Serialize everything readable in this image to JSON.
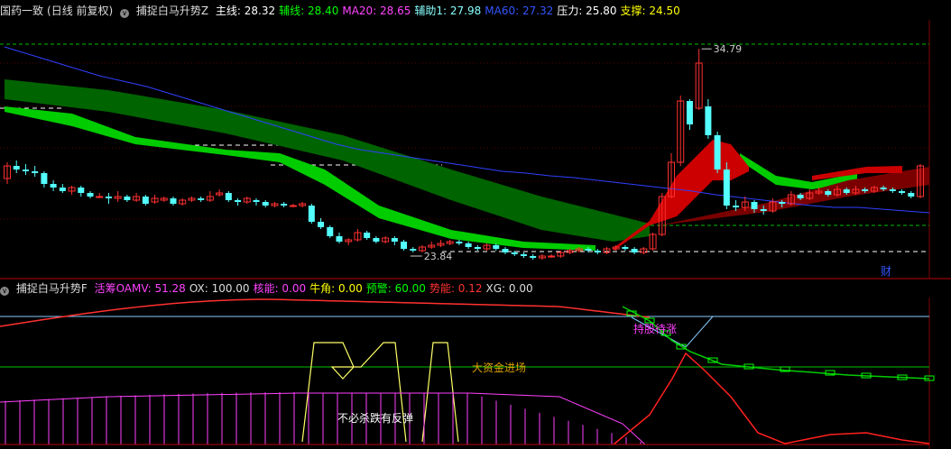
{
  "top_header": {
    "stock": "国药一致",
    "mode": "(日线 前复权)",
    "indicator": "捕捉白马升势Z",
    "items": [
      {
        "label": "主线:",
        "value": "28.32",
        "color": "#ffffff"
      },
      {
        "label": "辅线:",
        "value": "28.40",
        "color": "#00ff00"
      },
      {
        "label": "MA20:",
        "value": "28.65",
        "color": "#ff44ff"
      },
      {
        "label": "辅助1:",
        "value": "27.98",
        "color": "#88ffff"
      },
      {
        "label": "MA60:",
        "value": "27.32",
        "color": "#3355ff"
      },
      {
        "label": "压力:",
        "value": "25.80",
        "color": "#ffffff"
      },
      {
        "label": "支撑:",
        "value": "24.50",
        "color": "#ffff00"
      }
    ]
  },
  "bottom_header": {
    "indicator": "捕捉白马升势F",
    "items": [
      {
        "label": "活筹OAMV:",
        "value": "51.28",
        "color": "#ff44ff"
      },
      {
        "label": "OX:",
        "value": "100.00",
        "color": "#dddddd"
      },
      {
        "label": "核能:",
        "value": "0.00",
        "color": "#ff44ff"
      },
      {
        "label": "牛角:",
        "value": "0.00",
        "color": "#ffff00"
      },
      {
        "label": "预警:",
        "value": "60.00",
        "color": "#00ff00"
      },
      {
        "label": "势能:",
        "value": "0.12",
        "color": "#ff3333"
      },
      {
        "label": "XG:",
        "value": "0.00",
        "color": "#dddddd"
      }
    ]
  },
  "chart_data": {
    "type": "candlestick",
    "high_label": "34.79",
    "low_label": "23.84",
    "caiwu_marker": "财",
    "candles": [
      [
        27.6,
        28.3,
        28.5,
        27.3
      ],
      [
        28.3,
        28.1,
        28.6,
        27.9
      ],
      [
        28.1,
        28.0,
        28.4,
        27.8
      ],
      [
        28.0,
        27.9,
        28.3,
        27.7
      ],
      [
        27.9,
        27.3,
        28.0,
        27.1
      ],
      [
        27.3,
        27.1,
        27.5,
        26.9
      ],
      [
        27.1,
        26.9,
        27.3,
        26.8
      ],
      [
        26.9,
        27.1,
        27.2,
        26.7
      ],
      [
        27.1,
        26.8,
        27.2,
        26.6
      ],
      [
        26.8,
        26.6,
        26.9,
        26.5
      ],
      [
        26.6,
        26.6,
        26.8,
        26.5
      ],
      [
        26.6,
        26.5,
        26.8,
        26.2
      ],
      [
        26.5,
        26.6,
        26.9,
        26.3
      ],
      [
        26.6,
        26.4,
        26.7,
        26.3
      ],
      [
        26.4,
        26.6,
        26.8,
        26.3
      ],
      [
        26.6,
        26.2,
        26.7,
        26.1
      ],
      [
        26.3,
        26.5,
        26.7,
        26.2
      ],
      [
        26.4,
        26.5,
        26.6,
        26.3
      ],
      [
        26.5,
        26.2,
        26.6,
        26.1
      ],
      [
        26.2,
        26.4,
        26.5,
        26.1
      ],
      [
        26.4,
        26.5,
        26.6,
        26.3
      ],
      [
        26.5,
        26.4,
        26.6,
        26.3
      ],
      [
        26.4,
        26.6,
        26.9,
        26.3
      ],
      [
        26.7,
        26.8,
        27.0,
        26.6
      ],
      [
        26.8,
        26.4,
        26.9,
        26.3
      ],
      [
        26.4,
        26.3,
        26.5,
        26.1
      ],
      [
        26.3,
        26.5,
        26.6,
        26.2
      ],
      [
        26.4,
        26.3,
        26.5,
        26.1
      ],
      [
        26.3,
        26.1,
        26.4,
        26.0
      ],
      [
        26.1,
        26.2,
        26.3,
        26.0
      ],
      [
        26.2,
        26.1,
        26.3,
        26.0
      ],
      [
        26.1,
        26.1,
        26.2,
        26.0
      ],
      [
        26.1,
        26.2,
        26.3,
        26.0
      ],
      [
        26.1,
        25.2,
        26.2,
        25.1
      ],
      [
        25.2,
        24.9,
        25.4,
        24.8
      ],
      [
        24.9,
        24.4,
        25.0,
        24.3
      ],
      [
        24.4,
        24.1,
        24.6,
        24.0
      ],
      [
        24.1,
        24.2,
        24.3,
        23.9
      ],
      [
        24.2,
        24.6,
        24.8,
        24.1
      ],
      [
        24.6,
        24.3,
        24.7,
        24.2
      ],
      [
        24.3,
        24.1,
        24.4,
        24.0
      ],
      [
        24.1,
        24.3,
        24.4,
        24.0
      ],
      [
        24.3,
        24.1,
        24.4,
        23.9
      ],
      [
        24.1,
        23.7,
        24.2,
        23.6
      ],
      [
        23.7,
        23.6,
        23.8,
        23.5
      ],
      [
        23.6,
        23.8,
        23.9,
        23.5
      ],
      [
        23.8,
        23.9,
        24.1,
        23.7
      ],
      [
        23.9,
        24.0,
        24.2,
        23.8
      ],
      [
        24.0,
        24.1,
        24.2,
        23.9
      ],
      [
        24.1,
        24.0,
        24.2,
        23.9
      ],
      [
        24.0,
        23.8,
        24.1,
        23.7
      ],
      [
        23.8,
        23.7,
        23.9,
        23.6
      ],
      [
        23.7,
        23.9,
        24.0,
        23.6
      ],
      [
        23.9,
        23.7,
        24.0,
        23.6
      ],
      [
        23.7,
        23.5,
        23.8,
        23.4
      ],
      [
        23.5,
        23.4,
        23.6,
        23.3
      ],
      [
        23.4,
        23.3,
        23.5,
        23.2
      ],
      [
        23.3,
        23.2,
        23.4,
        23.1
      ],
      [
        23.2,
        23.3,
        23.4,
        23.1
      ],
      [
        23.3,
        23.3,
        23.4,
        23.2
      ],
      [
        23.3,
        23.5,
        23.6,
        23.2
      ],
      [
        23.5,
        23.6,
        23.7,
        23.4
      ],
      [
        23.6,
        23.7,
        23.8,
        23.5
      ],
      [
        23.7,
        23.6,
        23.8,
        23.5
      ],
      [
        23.6,
        23.5,
        23.7,
        23.4
      ],
      [
        23.5,
        23.7,
        23.8,
        23.4
      ],
      [
        23.7,
        23.8,
        23.9,
        23.6
      ],
      [
        23.8,
        23.7,
        23.9,
        23.6
      ],
      [
        23.7,
        23.5,
        23.8,
        23.4
      ],
      [
        23.5,
        23.7,
        23.8,
        23.4
      ],
      [
        23.7,
        24.5,
        24.6,
        23.6
      ],
      [
        24.5,
        26.6,
        26.8,
        24.4
      ],
      [
        26.6,
        28.5,
        29.0,
        26.5
      ],
      [
        28.5,
        31.9,
        32.2,
        28.3
      ],
      [
        31.9,
        30.6,
        32.0,
        30.3
      ],
      [
        31.5,
        34.0,
        34.79,
        31.4
      ],
      [
        31.6,
        30.0,
        32.0,
        29.8
      ],
      [
        30.0,
        28.1,
        30.2,
        27.9
      ],
      [
        28.1,
        26.1,
        28.5,
        25.9
      ],
      [
        26.1,
        26.0,
        26.4,
        25.8
      ],
      [
        26.0,
        26.3,
        26.6,
        25.8
      ],
      [
        26.3,
        25.9,
        26.4,
        25.7
      ],
      [
        25.9,
        25.8,
        26.1,
        25.6
      ],
      [
        25.8,
        26.3,
        26.5,
        25.7
      ],
      [
        26.3,
        26.2,
        26.4,
        26.0
      ],
      [
        26.2,
        26.7,
        26.9,
        26.1
      ],
      [
        26.7,
        26.5,
        26.8,
        26.4
      ],
      [
        26.5,
        26.8,
        27.0,
        26.4
      ],
      [
        26.8,
        26.9,
        27.1,
        26.7
      ],
      [
        26.9,
        26.7,
        27.0,
        26.6
      ],
      [
        26.7,
        27.0,
        27.2,
        26.6
      ],
      [
        27.0,
        26.8,
        27.1,
        26.7
      ],
      [
        26.8,
        27.0,
        27.2,
        26.7
      ],
      [
        27.0,
        26.9,
        27.1,
        26.8
      ],
      [
        26.9,
        27.1,
        27.2,
        26.8
      ],
      [
        27.1,
        27.0,
        27.2,
        26.9
      ],
      [
        27.0,
        26.9,
        27.1,
        26.8
      ],
      [
        26.9,
        26.8,
        27.0,
        26.7
      ],
      [
        26.8,
        26.6,
        26.9,
        26.5
      ],
      [
        26.6,
        28.3,
        28.4,
        26.5
      ]
    ],
    "ma60": [
      30.8,
      30.7,
      30.6,
      30.5,
      30.4,
      30.3,
      30.1,
      30.0,
      29.8,
      29.6,
      29.4,
      29.2,
      29.0,
      28.8,
      28.6,
      28.4,
      28.2,
      28.0,
      27.8,
      27.6,
      27.4,
      27.2,
      27.0,
      26.8,
      26.6,
      26.5,
      26.4,
      26.3,
      26.2,
      26.1,
      26.0,
      25.9,
      25.9,
      25.8,
      25.7,
      25.6
    ],
    "ma60_after": [
      26.2,
      26.1,
      26.0,
      25.9,
      25.7
    ]
  },
  "osc_labels": {
    "hold_label": "持股待涨",
    "fund_label": "大资金进场",
    "bounce_label": "不必杀跌有反弹"
  },
  "colors": {
    "up": "#ff3030",
    "down": "#54ffff",
    "band_dark_green": "#006400",
    "band_green": "#00cc00",
    "band_red": "#cc0000",
    "band_dark_red": "#7a0000",
    "ma60": "#3040ff"
  }
}
